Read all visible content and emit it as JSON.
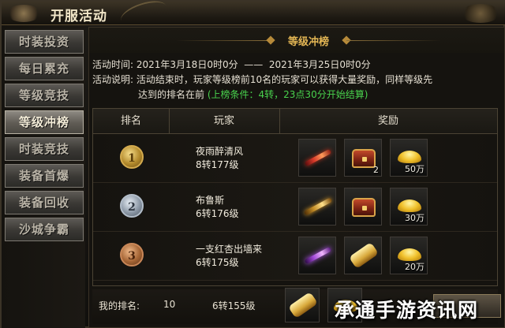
{
  "window": {
    "title": "开服活动"
  },
  "sidebar": {
    "items": [
      {
        "label": "时装投资"
      },
      {
        "label": "每日累充"
      },
      {
        "label": "等级竞技"
      },
      {
        "label": "等级冲榜"
      },
      {
        "label": "时装竞技"
      },
      {
        "label": "装备首爆"
      },
      {
        "label": "装备回收"
      },
      {
        "label": "沙城争霸"
      }
    ],
    "active_index": 3
  },
  "panel": {
    "title": "等级冲榜",
    "time_label": "活动时间:",
    "time_start": "2021年3月18日0时0分",
    "time_sep": "——",
    "time_end": "2021年3月25日0时0分",
    "desc_label": "活动说明:",
    "desc_line1": "活动结束时，玩家等级榜前10名的玩家可以获得大量奖励，同样等级先",
    "desc_line2": "达到的排名在前",
    "desc_condition": "(上榜条件：4转，23点30分开始结算)"
  },
  "table": {
    "headers": {
      "rank": "排名",
      "player": "玩家",
      "reward": "奖励"
    },
    "rows": [
      {
        "rank": "1",
        "medal": "gold",
        "name": "夜雨醉清风",
        "level": "8转177级",
        "rewards": [
          {
            "icon": "red-sword-icon",
            "qty": ""
          },
          {
            "icon": "treasure-chest-icon",
            "qty": "2"
          },
          {
            "icon": "gold-ingot-icon",
            "qty": "50万"
          }
        ]
      },
      {
        "rank": "2",
        "medal": "silver",
        "name": "布鲁斯",
        "level": "6转176级",
        "rewards": [
          {
            "icon": "gold-sword-icon",
            "qty": ""
          },
          {
            "icon": "treasure-chest-icon",
            "qty": ""
          },
          {
            "icon": "gold-ingot-icon",
            "qty": "30万"
          }
        ]
      },
      {
        "rank": "3",
        "medal": "bronze",
        "name": "一支红杏出墙来",
        "level": "6转175级",
        "rewards": [
          {
            "icon": "purple-sword-icon",
            "qty": ""
          },
          {
            "icon": "scroll-icon",
            "qty": ""
          },
          {
            "icon": "gold-ingot-icon",
            "qty": "20万"
          }
        ]
      }
    ]
  },
  "footer": {
    "my_rank_label": "我的排名:",
    "my_rank": "10",
    "my_level": "6转155级",
    "rewards": [
      {
        "icon": "scroll-icon",
        "qty": ""
      },
      {
        "icon": "gold-ingot-icon",
        "qty": ""
      }
    ]
  },
  "watermark": "承通手游资讯网"
}
